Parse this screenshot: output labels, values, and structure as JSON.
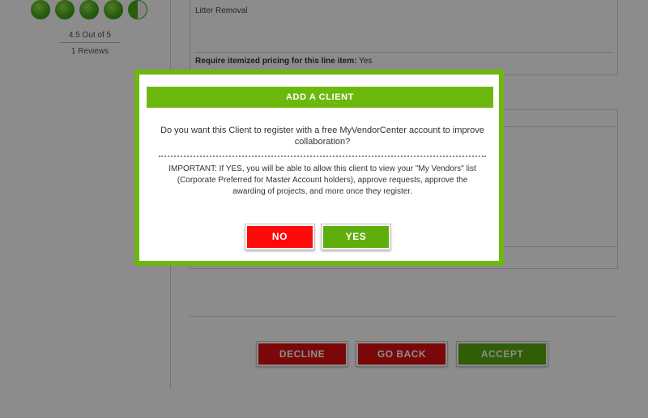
{
  "rating": {
    "text": "4.5 Out of 5",
    "reviews": "1 Reviews",
    "value": 4.5,
    "max": 5
  },
  "line_item": {
    "description": "Litter Removal",
    "pricing_label": "Require itemized pricing for this line item:",
    "pricing_value": "Yes"
  },
  "actions": {
    "decline": "DECLINE",
    "go_back": "GO BACK",
    "accept": "ACCEPT"
  },
  "modal": {
    "title": "ADD A CLIENT",
    "question": "Do you want this Client to register with a free MyVendorCenter account to improve collaboration?",
    "important": "IMPORTANT: If YES, you will be able to allow this client to view your \"My Vendors\" list (Corporate Preferred for Master Account holders), approve requests, approve the awarding of projects, and more once they register.",
    "no_label": "NO",
    "yes_label": "YES"
  },
  "colors": {
    "accent_green": "#6db80e",
    "danger_red": "#e01010"
  }
}
